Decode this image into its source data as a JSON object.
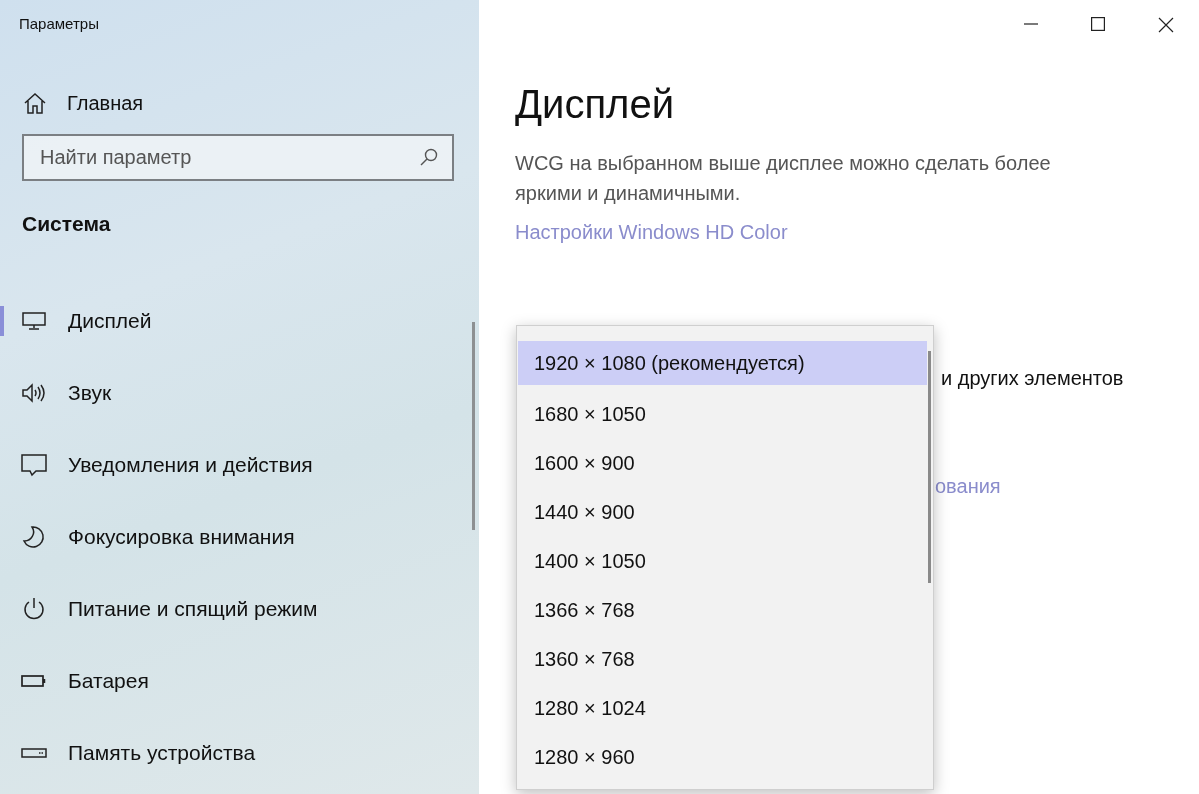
{
  "window": {
    "title": "Параметры"
  },
  "sidebar": {
    "home": "Главная",
    "search": {
      "placeholder": "Найти параметр"
    },
    "section": "Система",
    "items": [
      {
        "label": "Дисплей",
        "kind": "display",
        "selected": true
      },
      {
        "label": "Звук",
        "kind": "sound",
        "selected": false
      },
      {
        "label": "Уведомления и действия",
        "kind": "notifications",
        "selected": false
      },
      {
        "label": "Фокусировка внимания",
        "kind": "focus",
        "selected": false
      },
      {
        "label": "Питание и спящий режим",
        "kind": "power",
        "selected": false
      },
      {
        "label": "Батарея",
        "kind": "battery",
        "selected": false
      },
      {
        "label": "Память устройства",
        "kind": "storage",
        "selected": false
      }
    ]
  },
  "content": {
    "title": "Дисплей",
    "description": "WCG на выбранном выше дисплее можно сделать более яркими и динамичными.",
    "link": "Настройки Windows HD Color",
    "partial_text": "и других элементов",
    "partial_link": "ования"
  },
  "resolution_dropdown": {
    "options": [
      {
        "label": "1920 × 1080 (рекомендуется)",
        "selected": true
      },
      {
        "label": "1680 × 1050",
        "selected": false
      },
      {
        "label": "1600 × 900",
        "selected": false
      },
      {
        "label": "1440 × 900",
        "selected": false
      },
      {
        "label": "1400 × 1050",
        "selected": false
      },
      {
        "label": "1366 × 768",
        "selected": false
      },
      {
        "label": "1360 × 768",
        "selected": false
      },
      {
        "label": "1280 × 1024",
        "selected": false
      },
      {
        "label": "1280 × 960",
        "selected": false
      }
    ]
  }
}
